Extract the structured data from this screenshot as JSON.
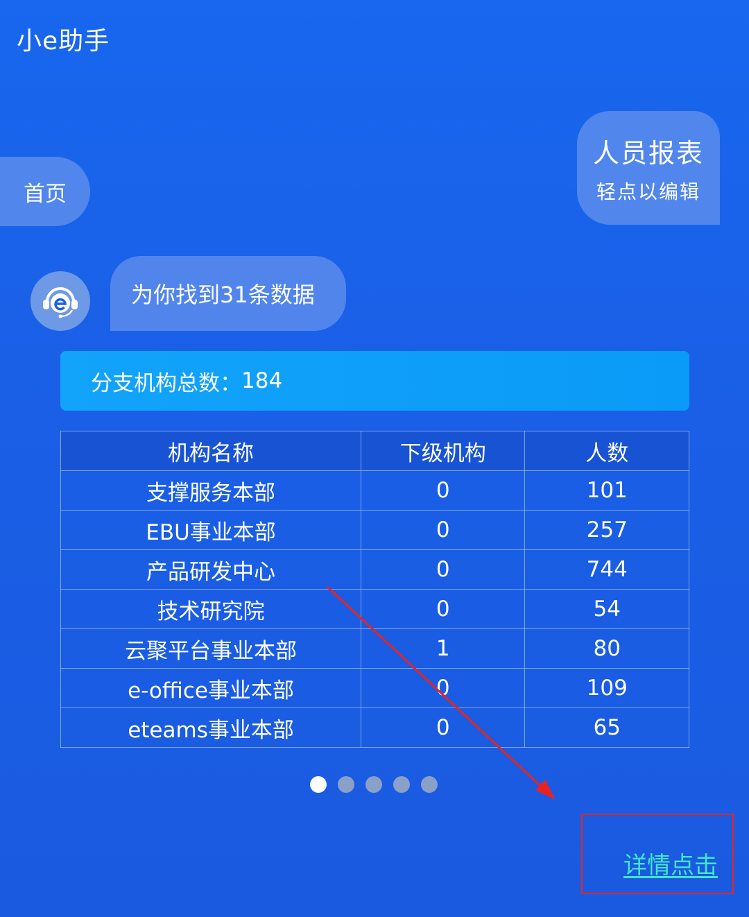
{
  "app": {
    "title": "小e助手"
  },
  "nav": {
    "home_label": "首页"
  },
  "report_card": {
    "title": "人员报表",
    "subtitle": "轻点以编辑"
  },
  "assistant": {
    "result_message": "为你找到31条数据"
  },
  "summary": {
    "label": "分支机构总数：",
    "value": "184"
  },
  "table": {
    "headers": [
      "机构名称",
      "下级机构",
      "人数"
    ],
    "rows": [
      [
        "支撑服务本部",
        "0",
        "101"
      ],
      [
        "EBU事业本部",
        "0",
        "257"
      ],
      [
        "产品研发中心",
        "0",
        "744"
      ],
      [
        "技术研究院",
        "0",
        "54"
      ],
      [
        "云聚平台事业本部",
        "1",
        "80"
      ],
      [
        "e-office事业本部",
        "0",
        "109"
      ],
      [
        "eteams事业本部",
        "0",
        "65"
      ]
    ]
  },
  "pagination": {
    "pages": 5,
    "active": 1
  },
  "detail_link": {
    "label": "详情点击"
  },
  "colors": {
    "background": "#1867ee",
    "summary_bar": "#12a3fb",
    "link": "#40e6c9",
    "annotation": "#e8231f"
  },
  "icons": {
    "assistant_avatar": "headset-e-icon"
  }
}
